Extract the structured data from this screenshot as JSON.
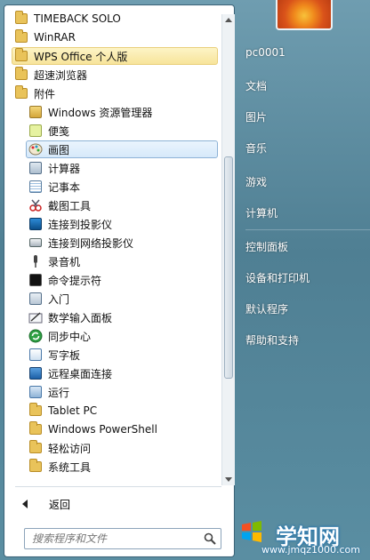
{
  "menu": {
    "items": [
      {
        "label": "TIMEBACK SOLO",
        "icon": "folder-icon"
      },
      {
        "label": "WinRAR",
        "icon": "folder-icon"
      },
      {
        "label": "WPS Office 个人版",
        "icon": "folder-icon"
      },
      {
        "label": "超速浏览器",
        "icon": "folder-icon"
      },
      {
        "label": "附件",
        "icon": "folder-icon"
      }
    ],
    "subitems": [
      {
        "label": "Windows 资源管理器",
        "icon": "explorer-icon"
      },
      {
        "label": "便笺",
        "icon": "sticky-notes-icon"
      },
      {
        "label": "画图",
        "icon": "paint-icon"
      },
      {
        "label": "计算器",
        "icon": "calculator-icon"
      },
      {
        "label": "记事本",
        "icon": "notepad-icon"
      },
      {
        "label": "截图工具",
        "icon": "snipping-tool-icon"
      },
      {
        "label": "连接到投影仪",
        "icon": "projector-icon"
      },
      {
        "label": "连接到网络投影仪",
        "icon": "network-projector-icon"
      },
      {
        "label": "录音机",
        "icon": "sound-recorder-icon"
      },
      {
        "label": "命令提示符",
        "icon": "command-prompt-icon"
      },
      {
        "label": "入门",
        "icon": "getting-started-icon"
      },
      {
        "label": "数学输入面板",
        "icon": "math-input-icon"
      },
      {
        "label": "同步中心",
        "icon": "sync-center-icon"
      },
      {
        "label": "写字板",
        "icon": "wordpad-icon"
      },
      {
        "label": "远程桌面连接",
        "icon": "remote-desktop-icon"
      },
      {
        "label": "运行",
        "icon": "run-icon"
      },
      {
        "label": "Tablet PC",
        "icon": "folder-icon"
      },
      {
        "label": "Windows PowerShell",
        "icon": "folder-icon"
      },
      {
        "label": "轻松访问",
        "icon": "folder-icon"
      },
      {
        "label": "系统工具",
        "icon": "folder-icon"
      }
    ],
    "back_label": "返回",
    "search_placeholder": "搜索程序和文件"
  },
  "right_panel": {
    "user": "pc0001",
    "items": [
      "文档",
      "图片",
      "音乐",
      "游戏",
      "计算机",
      "控制面板",
      "设备和打印机",
      "默认程序",
      "帮助和支持"
    ]
  },
  "watermark": {
    "title": "学知网",
    "url": "www.jmqz1000.com"
  },
  "colors": {
    "highlight_yellow": "#f7e49a",
    "highlight_blue": "#d6e9fa",
    "folder": "#e9c35a",
    "right_panel_bg": "#5a8ea2"
  }
}
